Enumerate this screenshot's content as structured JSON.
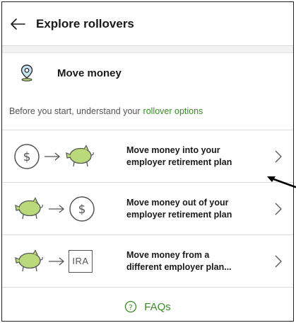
{
  "header": {
    "title": "Explore rollovers",
    "back_icon": "arrow-left-icon"
  },
  "section": {
    "title": "Move money",
    "icon": "location-pin-icon"
  },
  "intro": {
    "text": "Before you start, understand your",
    "link": "rollover options"
  },
  "options": [
    {
      "line1": "Move money into your",
      "line2": "employer retirement plan",
      "from": "dollar-icon",
      "to": "piggy-bank-icon"
    },
    {
      "line1": "Move money out of your",
      "line2": "employer retirement plan",
      "from": "piggy-bank-icon",
      "to": "dollar-icon"
    },
    {
      "line1": "Move money from a",
      "line2": "different employer plan...",
      "from": "piggy-bank-icon",
      "to": "ira-icon"
    }
  ],
  "ira_label": "IRA",
  "faq": {
    "label": "FAQs",
    "icon": "question-circle-icon"
  },
  "colors": {
    "accent_green": "#3a8a24",
    "icon_green": "#b9d97a",
    "border": "#dcdcdc"
  }
}
